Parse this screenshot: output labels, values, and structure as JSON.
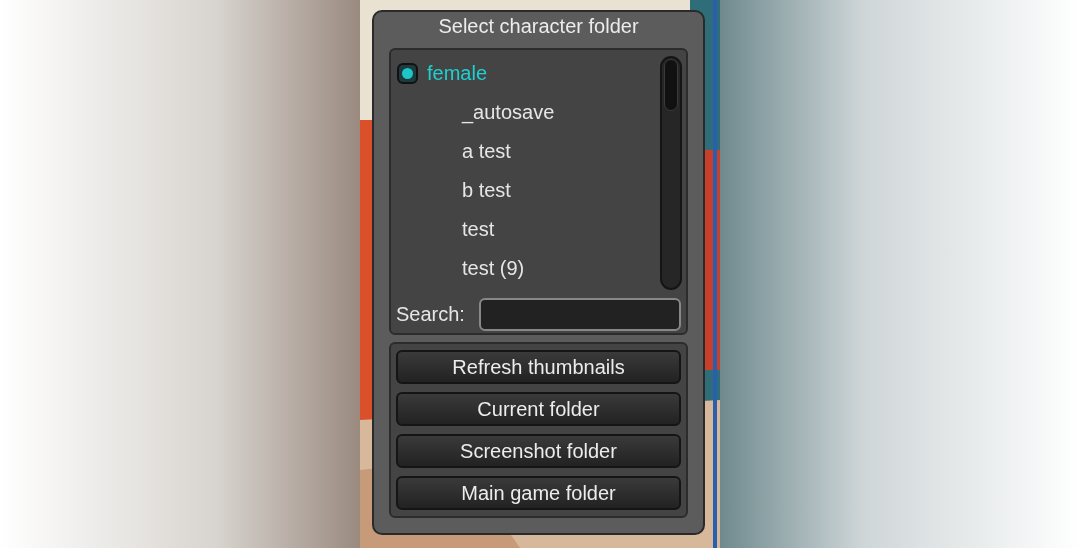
{
  "window": {
    "title": "Select character folder"
  },
  "tree": [
    {
      "label": "female",
      "selected": true,
      "children": [
        {
          "label": "_autosave",
          "selected": false
        },
        {
          "label": "a test",
          "selected": false
        },
        {
          "label": "b test",
          "selected": false
        },
        {
          "label": "test",
          "selected": false
        },
        {
          "label": "test (9)",
          "selected": false
        }
      ]
    }
  ],
  "search": {
    "label": "Search:"
  },
  "buttons": [
    "Refresh thumbnails",
    "Current folder",
    "Screenshot folder",
    "Main game folder"
  ]
}
